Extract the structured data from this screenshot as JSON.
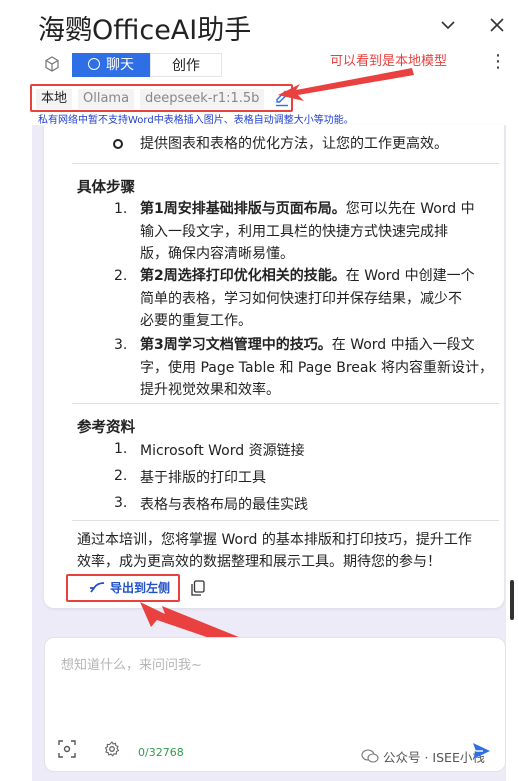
{
  "header": {
    "app_title": "海鹦OfficeAI助手",
    "collapse_icon": "chevron-down-icon",
    "close_icon": "close-icon"
  },
  "toolbar": {
    "tabs": [
      {
        "label": "聊天",
        "active": true
      },
      {
        "label": "创作",
        "active": false
      }
    ],
    "annotation": "可以看到是本地模型",
    "more_icon": "kebab-menu-icon"
  },
  "model_bar": {
    "scope": "本地",
    "provider": "Ollama",
    "model": "deepseek-r1:1.5b"
  },
  "warning": "私有网络中暂不支持Word中表格插入图片、表格自动调整大小等功能。",
  "message": {
    "top_bullet": "提供图表和表格的优化方法，让您的工作更高效。",
    "steps_heading": "具体步骤",
    "steps": [
      {
        "num": "1.",
        "bold": "第1周安排基础排版与页面布局。",
        "line1_rest": "您可以先在 Word 中",
        "line2": "输入一段文字，利用工具栏的快捷方式快速完成排",
        "line3": "版，确保内容清晰易懂。"
      },
      {
        "num": "2.",
        "bold": "第2周选择打印优化相关的技能。",
        "line1_rest": "在 Word 中创建一个",
        "line2": "简单的表格，学习如何快速打印并保存结果，减少不",
        "line3": "必要的重复工作。"
      },
      {
        "num": "3.",
        "bold": "第3周学习文档管理中的技巧。",
        "line1_rest": "在 Word 中插入一段文",
        "line2": "字，使用 Page Table 和 Page Break 将内容重新设计，",
        "line3": "提升视觉效果和效率。"
      }
    ],
    "refs_heading": "参考资料",
    "refs": [
      {
        "num": "1.",
        "text": "Microsoft Word 资源链接"
      },
      {
        "num": "2.",
        "text": "基于排版的打印工具"
      },
      {
        "num": "3.",
        "text": "表格与表格布局的最佳实践"
      }
    ],
    "summary_line1": "通过本培训，您将掌握 Word 的基本排版和打印技巧，提升工作",
    "summary_line2": "效率，成为更高效的数据整理和展示工具。期待您的参与！",
    "export_label": "导出到左侧"
  },
  "input": {
    "placeholder": "想知道什么，来问问我~",
    "counter": "0/32768"
  },
  "watermark": "公众号 · ISEE小栈",
  "colors": {
    "accent": "#2f6fe6",
    "annotation_red": "#e8413f",
    "chat_bg": "#ecebf7",
    "counter_green": "#2e9e4b",
    "warning_blue": "#1f3fd0"
  }
}
